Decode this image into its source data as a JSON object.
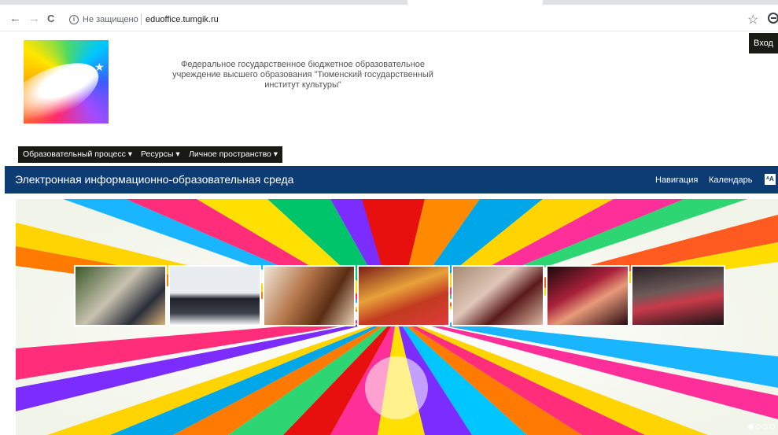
{
  "browser": {
    "back_icon": "arrow-left-icon",
    "forward_icon": "arrow-right-icon",
    "reload_icon": "reload-icon",
    "security_label": "Не защищено",
    "url": "eduoffice.tumgik.ru",
    "back_glyph": "←",
    "forward_glyph": "→",
    "reload_glyph": "C",
    "star_glyph": "☆"
  },
  "header": {
    "login_label": "Вход",
    "org_title": "Федеральное государственное бюджетное образовательное учреждение высшего образования \"Тюменский государственный институт культуры\""
  },
  "menu": {
    "items": [
      {
        "label": "Образовательный процесс ▾"
      },
      {
        "label": "Ресурсы ▾"
      },
      {
        "label": "Личное пространство ▾"
      }
    ]
  },
  "navbar": {
    "site_name": "Электронная информационно-образовательная среда",
    "links": [
      {
        "label": "Навигация"
      },
      {
        "label": "Календарь"
      }
    ],
    "lang_icon_glyph": "ᴬA"
  },
  "banner": {
    "slide_count": 4,
    "active_slide": 1,
    "photos": [
      "graduates",
      "winter-group",
      "writing",
      "girl-in-scarf",
      "awards",
      "dancers",
      "stage-group"
    ]
  },
  "colors": {
    "navbar": "#0d3b74",
    "menu": "#1a1a14"
  }
}
